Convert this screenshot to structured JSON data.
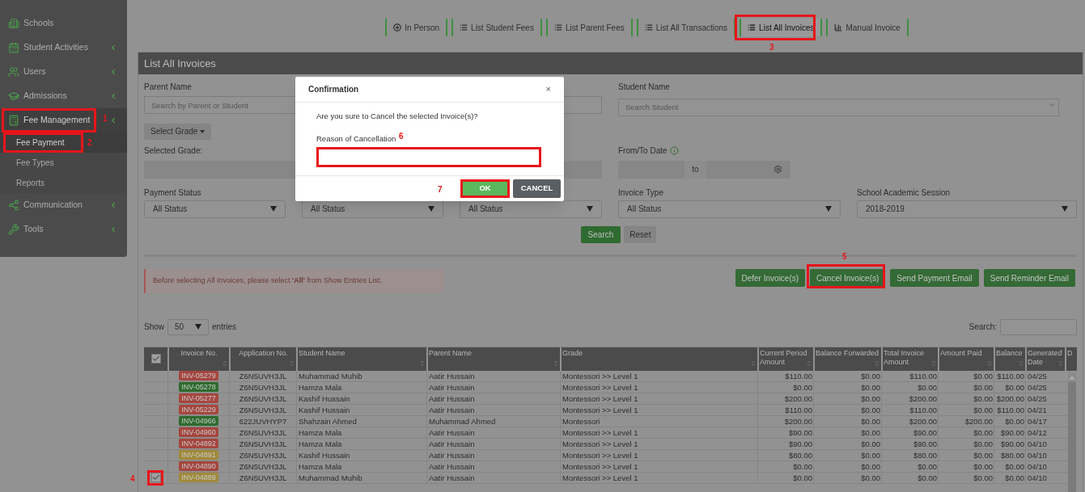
{
  "sidebar": {
    "items": [
      {
        "label": "Schools",
        "has_submenu": false,
        "selected": false
      },
      {
        "label": "Student Activities",
        "has_submenu": true,
        "selected": false
      },
      {
        "label": "Users",
        "has_submenu": true,
        "selected": false
      },
      {
        "label": "Admissions",
        "has_submenu": true,
        "selected": false
      },
      {
        "label": "Fee Management",
        "has_submenu": true,
        "expanded": true,
        "selected": true,
        "children": [
          {
            "label": "Fee Payment",
            "selected": true
          },
          {
            "label": "Fee Types",
            "selected": false
          },
          {
            "label": "Reports",
            "selected": false
          }
        ]
      },
      {
        "label": "Communication",
        "has_submenu": true,
        "selected": false
      },
      {
        "label": "Tools",
        "has_submenu": true,
        "selected": false
      }
    ]
  },
  "nav_buttons": [
    {
      "label": "In Person",
      "selected": false
    },
    {
      "label": "List Student Fees",
      "selected": false
    },
    {
      "label": "List Parent Fees",
      "selected": false
    },
    {
      "label": "List All Transactions",
      "selected": false
    },
    {
      "label": "List All Invoices",
      "selected": true
    },
    {
      "label": "Manual Invoice",
      "selected": false
    }
  ],
  "panel": {
    "title": "List All Invoices",
    "parent_name": {
      "label": "Parent Name",
      "placeholder": "Search by Parent or Student"
    },
    "student_name": {
      "label": "Student Name",
      "placeholder": "Search Student"
    },
    "select_grade": "Select Grade",
    "selected_grade": {
      "label": "Selected Grade:"
    },
    "date": {
      "label": "From/To Date",
      "to": "to"
    },
    "selects": [
      {
        "label": "Payment Status",
        "value": "All Status"
      },
      {
        "value": "All Status"
      },
      {
        "value": "All Status"
      },
      {
        "label": "Invoice Type",
        "value": "All Status"
      },
      {
        "label": "School Academic Session",
        "value": "2018-2019"
      }
    ],
    "search_button": "Search",
    "reset_button": "Reset",
    "alert": "Before selecting All Invoices, please select **'All'** from Show Entries List.",
    "actions": [
      "Defer Invoice(s)",
      "Cancel Invoice(s)",
      "Send Payment Email",
      "Send Reminder Email"
    ],
    "show": "Show",
    "entries_value": "50",
    "entries": "entries",
    "search_label": "Search:"
  },
  "table": {
    "header_checked": true,
    "columns": [
      "Invoice No.",
      "Application No.",
      "Student Name",
      "Parent Name",
      "Grade",
      "Current Period Amount",
      "Balance Forwarded",
      "Total Invoice Amount",
      "Amount Paid",
      "Balance",
      "Generated Date",
      "D"
    ],
    "rows": [
      {
        "checked": false,
        "color": "#a5463f",
        "cells": [
          "INV-05279",
          "Z6N5UVH3JL",
          "Muhammad Muhib",
          "Aatir Hussain",
          "Montessori >> Level 1",
          "$110.00",
          "$0.00",
          "$110.00",
          "$0.00",
          "$110.00",
          "04/25"
        ]
      },
      {
        "checked": false,
        "color": "#2e6b2e",
        "cells": [
          "INV-05278",
          "Z6N5UVH3JL",
          "Hamza Mala",
          "Aatir Hussain",
          "Montessori >> Level 1",
          "$0.00",
          "$0.00",
          "$0.00",
          "$0.00",
          "$0.00",
          "04/25"
        ]
      },
      {
        "checked": false,
        "color": "#a5463f",
        "cells": [
          "INV-05277",
          "Z6N5UVH3JL",
          "Kashif Hussain",
          "Aatir Hussain",
          "Montessori >> Level 1",
          "$200.00",
          "$0.00",
          "$200.00",
          "$0.00",
          "$200.00",
          "04/25"
        ]
      },
      {
        "checked": false,
        "color": "#a5463f",
        "cells": [
          "INV-05229",
          "Z6N5UVH3JL",
          "Kashif Hussain",
          "Aatir Hussain",
          "Montessori >> Level 1",
          "$110.00",
          "$0.00",
          "$110.00",
          "$0.00",
          "$110.00",
          "04/21"
        ]
      },
      {
        "checked": false,
        "color": "#2e6b2e",
        "cells": [
          "INV-04966",
          "622JUVHYP7",
          "Shahzain Ahmed",
          "Muhammad Ahmed",
          "Montessori",
          "$200.00",
          "$0.00",
          "$200.00",
          "$200.00",
          "$0.00",
          "04/17"
        ]
      },
      {
        "checked": false,
        "color": "#a5463f",
        "cells": [
          "INV-04960",
          "Z6N5UVH3JL",
          "Hamza Mala",
          "Aatir Hussain",
          "Montessori >> Level 1",
          "$90.00",
          "$0.00",
          "$90.00",
          "$0.00",
          "$90.00",
          "04/12"
        ]
      },
      {
        "checked": false,
        "color": "#a5463f",
        "cells": [
          "INV-04892",
          "Z6N5UVH3JL",
          "Hamza Mala",
          "Aatir Hussain",
          "Montessori >> Level 1",
          "$90.00",
          "$0.00",
          "$90.00",
          "$0.00",
          "$90.00",
          "04/10"
        ]
      },
      {
        "checked": false,
        "color": "#a08a3c",
        "cells": [
          "INV-04891",
          "Z6N5UVH3JL",
          "Kashif Hussain",
          "Aatir Hussain",
          "Montessori >> Level 1",
          "$80.00",
          "$0.00",
          "$80.00",
          "$0.00",
          "$80.00",
          "04/10"
        ]
      },
      {
        "checked": false,
        "color": "#a5463f",
        "cells": [
          "INV-04890",
          "Z6N5UVH3JL",
          "Hamza Mala",
          "Aatir Hussain",
          "Montessori >> Level 1",
          "$0.00",
          "$0.00",
          "$0.00",
          "$0.00",
          "$0.00",
          "04/10"
        ]
      },
      {
        "checked": true,
        "color": "#a08a3c",
        "cells": [
          "INV-04889",
          "Z6N5UVH3JL",
          "Muhammad Muhib",
          "Aatir Hussain",
          "Montessori >> Level 1",
          "$0.00",
          "$0.00",
          "$0.00",
          "$0.00",
          "$0.00",
          "04/10"
        ]
      }
    ]
  },
  "modal": {
    "title": "Confirmation",
    "close": "×",
    "message": "Are you sure to Cancel the selected Invoice(s)?",
    "field_label": "Reason of Cancellation",
    "ok": "OK",
    "cancel": "CANCEL"
  },
  "steps": {
    "fee_management": "1",
    "fee_payment": "2",
    "list_all_invoices": "3",
    "row_checkbox": "4",
    "cancel_button": "5",
    "reason_field": "6",
    "ok_button": "7"
  }
}
